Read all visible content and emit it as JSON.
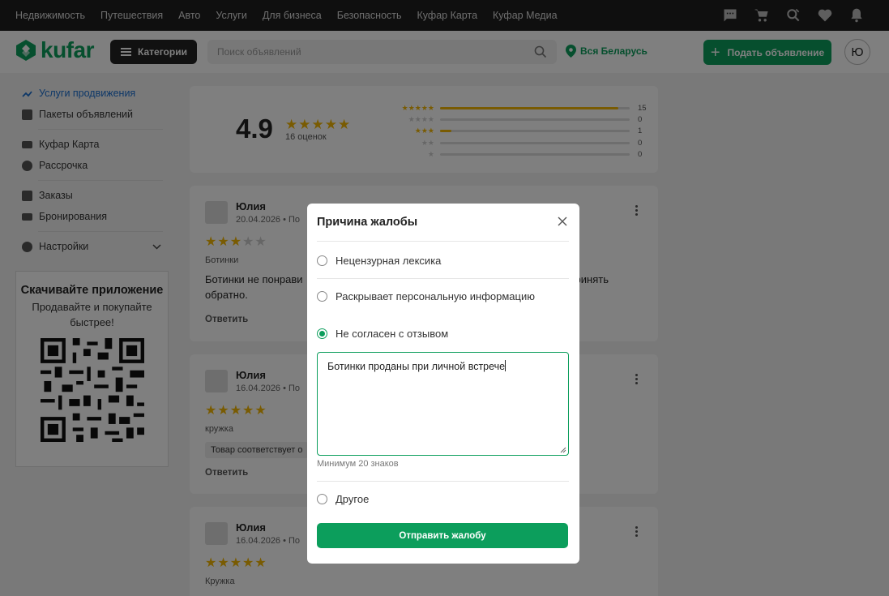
{
  "topnav": [
    "Недвижимость",
    "Путешествия",
    "Авто",
    "Услуги",
    "Для бизнеса",
    "Безопасность",
    "Куфар Карта",
    "Куфар Медиа"
  ],
  "header": {
    "brand": "kufar",
    "categories_label": "Категории",
    "search_placeholder": "Поиск объявлений",
    "region": "Вся Беларусь",
    "post_label": "Подать объявление",
    "avatar_letter": "Ю"
  },
  "sidebar": {
    "items": [
      "Услуги продвижения",
      "Пакеты объявлений",
      "Куфар Карта",
      "Рассрочка",
      "Заказы",
      "Бронирования",
      "Настройки"
    ],
    "app_title": "Скачивайте приложение",
    "app_subtitle": "Продавайте и покупайте быстрее!"
  },
  "rating": {
    "score": "4.9",
    "count_label": "16 оценок",
    "breakdown": [
      {
        "stars": 5,
        "count": "15",
        "fraction": 0.94
      },
      {
        "stars": 4,
        "count": "0",
        "fraction": 0
      },
      {
        "stars": 3,
        "count": "1",
        "fraction": 0.06
      },
      {
        "stars": 2,
        "count": "0",
        "fraction": 0
      },
      {
        "stars": 1,
        "count": "0",
        "fraction": 0
      }
    ]
  },
  "reviews": [
    {
      "name": "Юлия",
      "date": "20.04.2026 • По",
      "stars": 3,
      "product": "Ботинки",
      "text_start": "Ботинки не понрави",
      "text_end": "ринять",
      "text_line2": "обратно.",
      "reply": "Ответить"
    },
    {
      "name": "Юлия",
      "date": "16.04.2026 • По",
      "stars": 5,
      "product": "кружка",
      "tag": "Товар соответствует о",
      "reply": "Ответить"
    },
    {
      "name": "Юлия",
      "date": "16.04.2026 • По",
      "stars": 5,
      "product": "Кружка"
    }
  ],
  "modal": {
    "title": "Причина жалобы",
    "options": [
      {
        "label": "Нецензурная лексика",
        "selected": false
      },
      {
        "label": "Раскрывает персональную информацию",
        "selected": false
      },
      {
        "label": "Не согласен с отзывом",
        "selected": true
      },
      {
        "label": "Другое",
        "selected": false
      }
    ],
    "textarea_value": "Ботинки проданы при личной встрече",
    "hint": "Минимум 20 знаков",
    "submit_label": "Отправить жалобу"
  },
  "colors": {
    "accent": "#0c9e5c",
    "star": "#f2b705",
    "link": "#1a6fd1"
  }
}
